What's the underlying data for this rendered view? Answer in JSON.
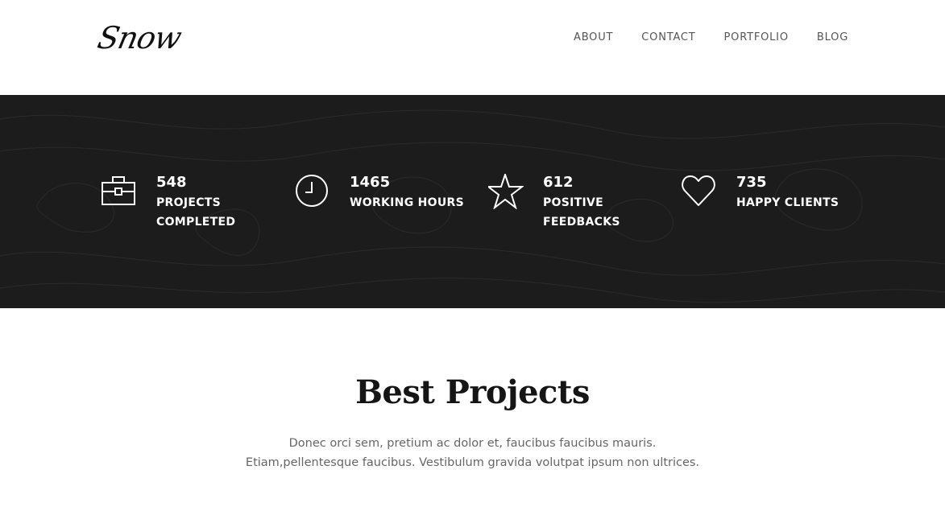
{
  "header": {
    "logo": "Snow",
    "nav": [
      "ABOUT",
      "CONTACT",
      "PORTFOLIO",
      "BLOG"
    ]
  },
  "stats": [
    {
      "number": "548",
      "label": "PROJECTS COMPLETED",
      "icon": "briefcase-icon"
    },
    {
      "number": "1465",
      "label": "WORKING HOURS",
      "icon": "clock-icon"
    },
    {
      "number": "612",
      "label": "POSITIVE FEEDBACKS",
      "icon": "star-icon"
    },
    {
      "number": "735",
      "label": "HAPPY CLIENTS",
      "icon": "heart-icon"
    }
  ],
  "projects": {
    "title": "Best Projects",
    "description_line1": "Donec orci sem, pretium ac dolor et, faucibus faucibus mauris.",
    "description_line2": "Etiam,pellentesque faucibus. Vestibulum gravida volutpat ipsum non ultrices."
  },
  "colors": {
    "band_background": "#1c1c1d",
    "text_dark": "#151515",
    "text_muted": "#666666"
  }
}
